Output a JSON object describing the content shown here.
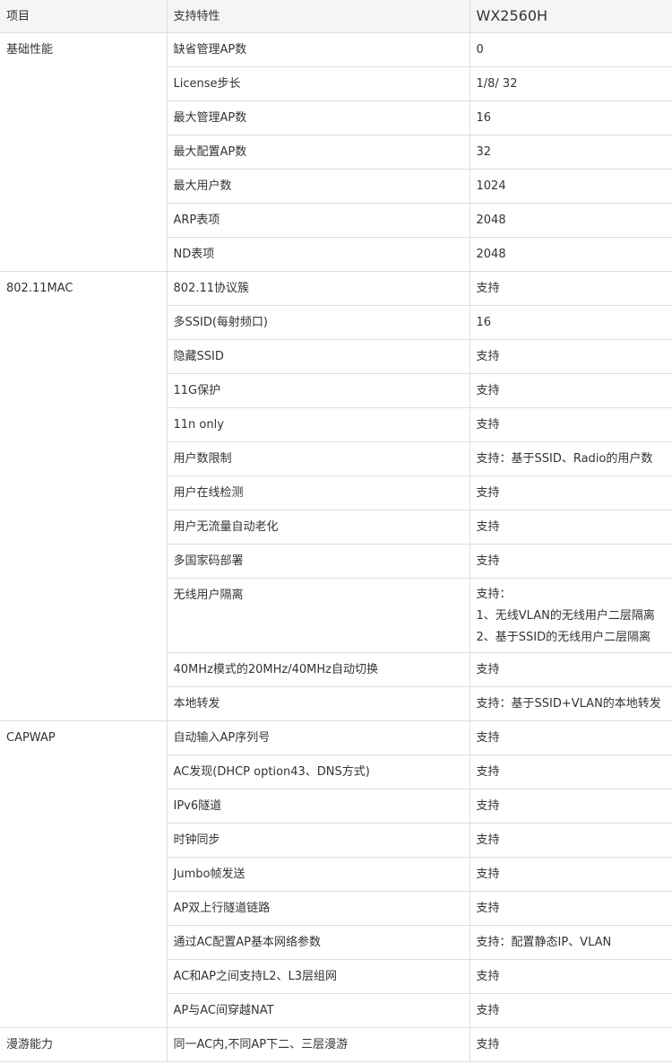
{
  "header": {
    "col1": "项目",
    "col2": "支持特性",
    "col3": "WX2560H"
  },
  "groups": [
    {
      "category": "基础性能",
      "rows": [
        {
          "feature": "缺省管理AP数",
          "value": "0"
        },
        {
          "feature": "License步长",
          "value": "1/8/ 32"
        },
        {
          "feature": "最大管理AP数",
          "value": "16"
        },
        {
          "feature": "最大配置AP数",
          "value": "32"
        },
        {
          "feature": "最大用户数",
          "value": "1024"
        },
        {
          "feature": "ARP表项",
          "value": "2048"
        },
        {
          "feature": "ND表项",
          "value": "2048"
        }
      ]
    },
    {
      "category": "802.11MAC",
      "rows": [
        {
          "feature": "802.11协议簇",
          "value": "支持"
        },
        {
          "feature": "多SSID(每射频口)",
          "value": "16"
        },
        {
          "feature": "隐藏SSID",
          "value": "支持"
        },
        {
          "feature": "11G保护",
          "value": "支持"
        },
        {
          "feature": "11n only",
          "value": "支持"
        },
        {
          "feature": "用户数限制",
          "value": "支持：基于SSID、Radio的用户数"
        },
        {
          "feature": "用户在线检测",
          "value": "支持"
        },
        {
          "feature": "用户无流量自动老化",
          "value": "支持"
        },
        {
          "feature": "多国家码部署",
          "value": "支持"
        },
        {
          "feature": "无线用户隔离",
          "value_lines": [
            "支持：",
            "1、无线VLAN的无线用户二层隔离",
            "2、基于SSID的无线用户二层隔离"
          ]
        },
        {
          "feature": "40MHz模式的20MHz/40MHz自动切换",
          "value": "支持"
        },
        {
          "feature": "本地转发",
          "value": "支持：基于SSID+VLAN的本地转发"
        }
      ]
    },
    {
      "category": "CAPWAP",
      "rows": [
        {
          "feature": "自动输入AP序列号",
          "value": "支持"
        },
        {
          "feature": "AC发现(DHCP option43、DNS方式)",
          "value": "支持"
        },
        {
          "feature": "IPv6隧道",
          "value": "支持"
        },
        {
          "feature": "时钟同步",
          "value": "支持"
        },
        {
          "feature": "Jumbo帧发送",
          "value": "支持"
        },
        {
          "feature": "AP双上行隧道链路",
          "value": "支持"
        },
        {
          "feature": "通过AC配置AP基本网络参数",
          "value": "支持：配置静态IP、VLAN"
        },
        {
          "feature": "AC和AP之间支持L2、L3层组网",
          "value": "支持"
        },
        {
          "feature": "AP与AC间穿越NAT",
          "value": "支持"
        }
      ]
    },
    {
      "category": "漫游能力",
      "rows": [
        {
          "feature": "同一AC内,不同AP下二、三层漫游",
          "value": "支持"
        }
      ]
    }
  ]
}
